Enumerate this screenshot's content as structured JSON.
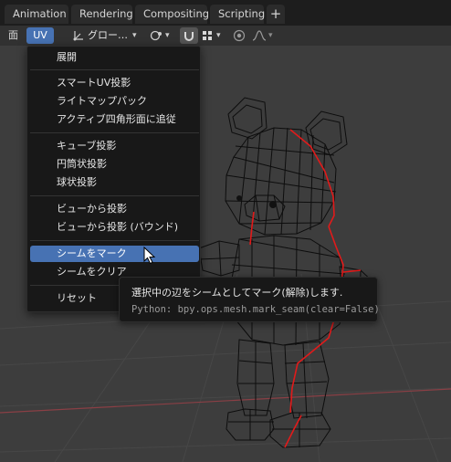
{
  "tabs": [
    "Animation",
    "Rendering",
    "Compositing",
    "Scripting",
    "+"
  ],
  "header": {
    "face_menu": "面",
    "uv_menu": "UV",
    "transform_orientation": "グロー…",
    "icons": [
      "transform-axes-icon",
      "pivot-point-icon",
      "snap-magnet-icon",
      "snap-grid-icon",
      "proportional-edit-icon",
      "falloff-curve-icon"
    ]
  },
  "menu": {
    "items": [
      "展開",
      "スマートUV投影",
      "ライトマップパック",
      "アクティブ四角形面に追従",
      "キューブ投影",
      "円筒状投影",
      "球状投影",
      "ビューから投影",
      "ビューから投影 (バウンド)",
      "シームをマーク",
      "シームをクリア",
      "リセット"
    ],
    "highlighted": "シームをマーク"
  },
  "tooltip": {
    "description": "選択中の辺をシームとしてマーク(解除)します.",
    "python": "Python: bpy.ops.mesh.mark_seam(clear=False)"
  },
  "colors": {
    "accent": "#4772b3",
    "seam": "#e11a1a",
    "menu_bg": "#181818",
    "viewport_bg": "#3d3d3d"
  }
}
